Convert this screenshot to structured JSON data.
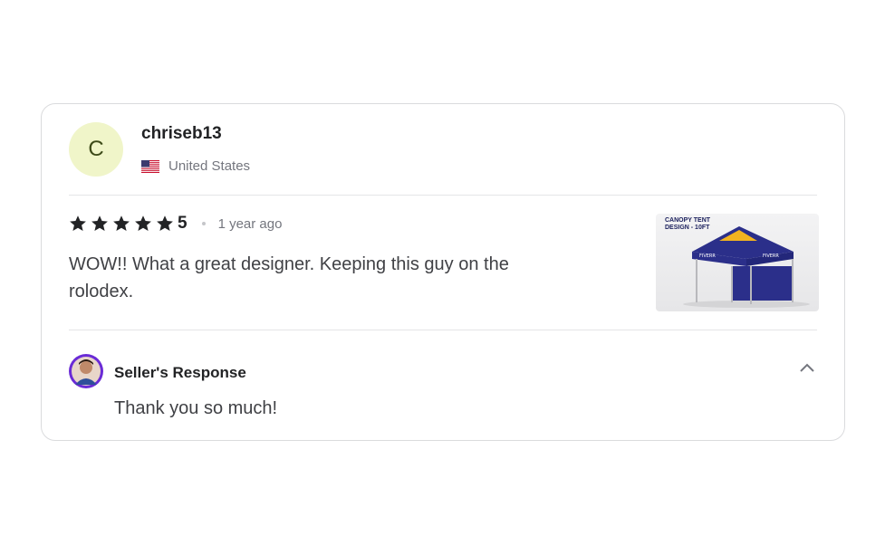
{
  "review": {
    "reviewer": {
      "initial": "C",
      "username": "chriseb13",
      "country": "United States",
      "flag_icon": "us-flag-icon"
    },
    "rating": {
      "stars": 5,
      "score_label": "5",
      "time_ago": "1 year ago"
    },
    "text": "WOW!! What a great designer. Keeping this guy on the rolodex.",
    "thumbnail": {
      "caption_line1": "CANOPY TENT",
      "caption_line2": "DESIGN - 10FT"
    },
    "seller_response": {
      "title": "Seller's Response",
      "text": "Thank you so much!",
      "toggle_icon": "chevron-up-icon"
    }
  },
  "colors": {
    "star": "#222325",
    "avatar_bg": "#f0f5c9",
    "seller_avatar_ring": "#6a2bd6",
    "tent_blue": "#2b2f8a"
  }
}
